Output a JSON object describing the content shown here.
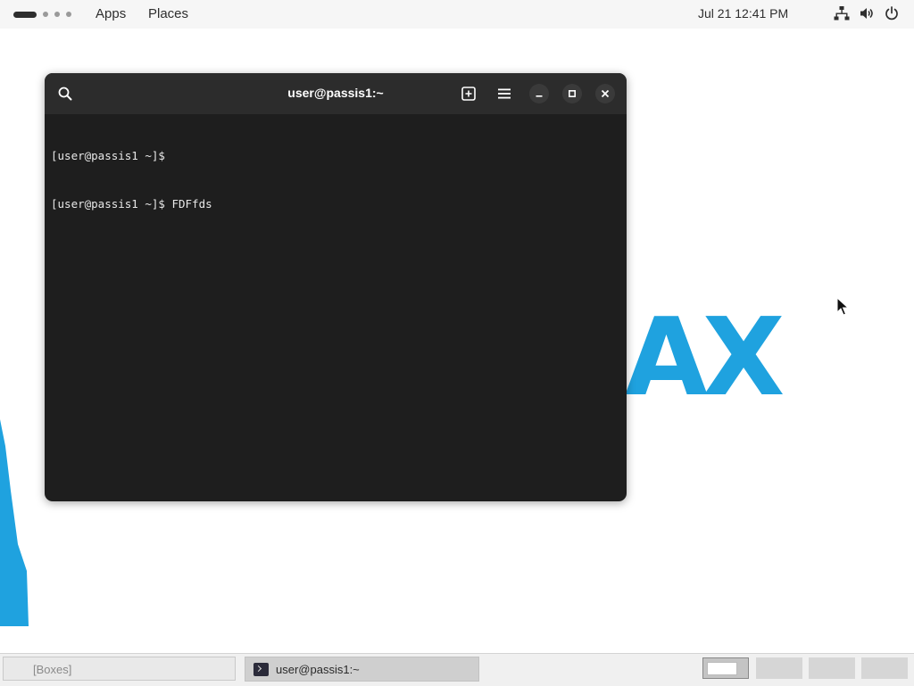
{
  "topbar": {
    "apps_label": "Apps",
    "places_label": "Places",
    "clock": "Jul 21  12:41 PM",
    "tray_icons": [
      "network-icon",
      "volume-icon",
      "power-icon"
    ]
  },
  "wallpaper": {
    "logo_text": "AX",
    "accent_color": "#1fa2df"
  },
  "terminal": {
    "title": "user@passis1:~",
    "lines": [
      "[user@passis1 ~]$",
      "[user@passis1 ~]$ FDFfds"
    ],
    "colors": {
      "header": "#2c2c2c",
      "body": "#1e1e1e",
      "text": "#e8e8e8"
    }
  },
  "taskbar": {
    "boxes_label": "[Boxes]",
    "terminal_label": "user@passis1:~",
    "workspaces_count": 4,
    "active_workspace": 1
  }
}
